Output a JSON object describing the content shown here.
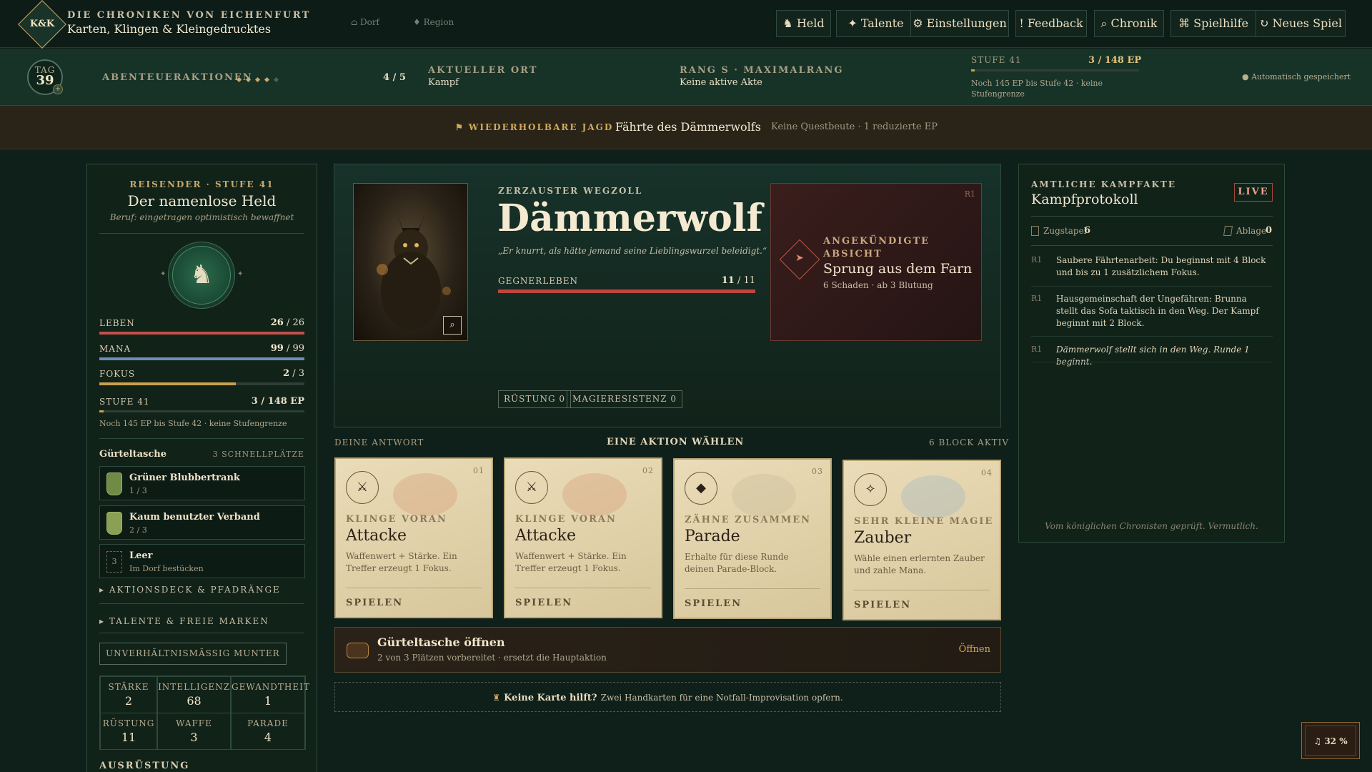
{
  "header": {
    "logo": "K&K",
    "brand_top": "DIE CHRONIKEN VON EICHENFURT",
    "brand_sub": "Karten, Klingen & Kleingedrucktes",
    "nav_village": "⌂ Dorf",
    "nav_region": "♦ Region",
    "buttons": [
      "♞ Held",
      "✦ Talente",
      "⚙ Einstellungen",
      "! Feedback",
      "⌕ Chronik",
      "⌘ Spielhilfe",
      "↻ Neues Spiel"
    ]
  },
  "status": {
    "day_label": "TAG",
    "day_value": "39",
    "actions_label": "ABENTEUERAKTIONEN",
    "actions_value": "4 / 5",
    "actions_filled": 4,
    "actions_total": 5,
    "location_label": "AKTUELLER ORT",
    "location_value": "Kampf",
    "rank_label": "RANG S · MAXIMALRANG",
    "rank_value": "Keine aktive Akte",
    "level_label": "STUFE 41",
    "level_xp": "3 / 148 EP",
    "level_fraction": 0.02,
    "level_note": "Noch 145 EP bis Stufe 42 · keine Stufengrenze",
    "autosave": "● Automatisch gespeichert"
  },
  "banner": {
    "tag": "⚑ WIEDERHOLBARE JAGD",
    "title": "Fährte des Dämmerwolfs",
    "note": "Keine Questbeute · 1 reduzierte EP"
  },
  "hero": {
    "subtitle": "REISENDER · STUFE 41",
    "name": "Der namenlose Held",
    "profession": "Beruf: eingetragen optimistisch bewaffnet",
    "portrait_glyph": "♞",
    "life_label": "LEBEN",
    "life_cur": "26",
    "life_max": "/ 26",
    "life_fraction": 1.0,
    "mana_label": "MANA",
    "mana_cur": "99",
    "mana_max": "/ 99",
    "mana_fraction": 1.0,
    "focus_label": "FOKUS",
    "focus_cur": "2",
    "focus_max": "/ 3",
    "focus_fraction": 0.667,
    "level_label": "STUFE 41",
    "level_xp": "3 / 148 EP",
    "level_fraction": 0.02,
    "level_note": "Noch 145 EP bis Stufe 42 · keine Stufengrenze",
    "belt_label": "Gürteltasche",
    "belt_slots": "3 SCHNELLPLÄTZE",
    "belt": [
      {
        "name": "Grüner Blubbertrank",
        "sub": "1 / 3"
      },
      {
        "name": "Kaum benutzter Verband",
        "sub": "2 / 3"
      },
      {
        "name": "Leer",
        "sub": "Im Dorf bestücken",
        "slot": "3"
      }
    ],
    "deck_toggle": "▸ AKTIONSDECK & PFADRÄNGE",
    "talent_toggle": "▸ TALENTE & FREIE MARKEN",
    "mood": "UNVERHÄLTNISMÄSSIG MUNTER",
    "stats": [
      {
        "k": "STÄRKE",
        "v": "2"
      },
      {
        "k": "INTELLIGENZ",
        "v": "68"
      },
      {
        "k": "GEWANDTHEIT",
        "v": "1"
      },
      {
        "k": "RÜSTUNG",
        "v": "11"
      },
      {
        "k": "WAFFE",
        "v": "3"
      },
      {
        "k": "PARADE",
        "v": "4"
      }
    ],
    "equipment_label": "AUSRÜSTUNG"
  },
  "enemy": {
    "subtitle": "ZERZAUSTER WEGZOLL",
    "name": "Dämmerwolf",
    "quote": "„Er knurrt, als hätte jemand seine Lieblingswurzel beleidigt.“",
    "hp_label": "GEGNERLEBEN",
    "hp_cur": "11",
    "hp_max": "/ 11",
    "hp_fraction": 1.0,
    "zoom_glyph": "⌕",
    "armor": "RÜSTUNG 0",
    "magic_res": "MAGIERESISTENZ 0",
    "intent_round": "R1",
    "intent_label": "ANGEKÜNDIGTE ABSICHT",
    "intent_name": "Sprung aus dem Farn",
    "intent_detail": "6 Schaden · ab 3 Blutung"
  },
  "actions": {
    "left": "DEINE ANTWORT",
    "center": "EINE AKTION WÄHLEN",
    "right": "6 BLOCK AKTIV",
    "cards": [
      {
        "num": "01",
        "icon": "⚔",
        "sub": "KLINGE VORAN",
        "title": "Attacke",
        "desc": "Waffenwert + Stärke. Ein Treffer erzeugt 1 Fokus.",
        "play": "SPIELEN",
        "glow": "#d08060"
      },
      {
        "num": "02",
        "icon": "⚔",
        "sub": "KLINGE VORAN",
        "title": "Attacke",
        "desc": "Waffenwert + Stärke. Ein Treffer erzeugt 1 Fokus.",
        "play": "SPIELEN",
        "glow": "#d08060"
      },
      {
        "num": "03",
        "icon": "◆",
        "sub": "ZÄHNE ZUSAMMEN",
        "title": "Parade",
        "desc": "Erhalte für diese Runde deinen Parade-Block.",
        "play": "SPIELEN",
        "glow": "#b8b090"
      },
      {
        "num": "04",
        "icon": "✧",
        "sub": "SEHR KLEINE MAGIE",
        "title": "Zauber",
        "desc": "Wähle einen erlernten Zauber und zahle Mana.",
        "play": "SPIELEN",
        "glow": "#80a8c8"
      }
    ],
    "belt_title": "Gürteltasche öffnen",
    "belt_sub": "2 von 3 Plätzen vorbereitet · ersetzt die Hauptaktion",
    "belt_btn": "Öffnen",
    "fallback_bold": "Keine Karte hilft?",
    "fallback_text": "Zwei Handkarten für eine Notfall-Improvisation opfern.",
    "fallback_icon": "♜"
  },
  "log": {
    "label": "AMTLICHE KAMPFAKTE",
    "title": "Kampfprotokoll",
    "live": "LIVE",
    "draw_label": "Zugstapel",
    "draw_value": "6",
    "discard_label": "Ablage",
    "discard_value": "0",
    "entries": [
      {
        "r": "R1",
        "t": "Saubere Fährtenarbeit: Du beginnst mit 4 Block und bis zu 1 zusätzlichem Fokus."
      },
      {
        "r": "R1",
        "t": "Hausgemeinschaft der Ungefähren: Brunna stellt das Sofa taktisch in den Weg. Der Kampf beginnt mit 2 Block."
      },
      {
        "r": "R1",
        "t": "Dämmerwolf stellt sich in den Weg. Runde 1 beginnt."
      }
    ],
    "footer": "Vom königlichen Chronisten geprüft. Vermutlich."
  },
  "music": {
    "icon": "♫",
    "volume": "32 %"
  },
  "colors": {
    "life": "#c0514a",
    "mana": "#6c8fb5",
    "focus": "#c9a04c",
    "accent": "#c9a96e",
    "enemy_hp": "#c0453e"
  }
}
